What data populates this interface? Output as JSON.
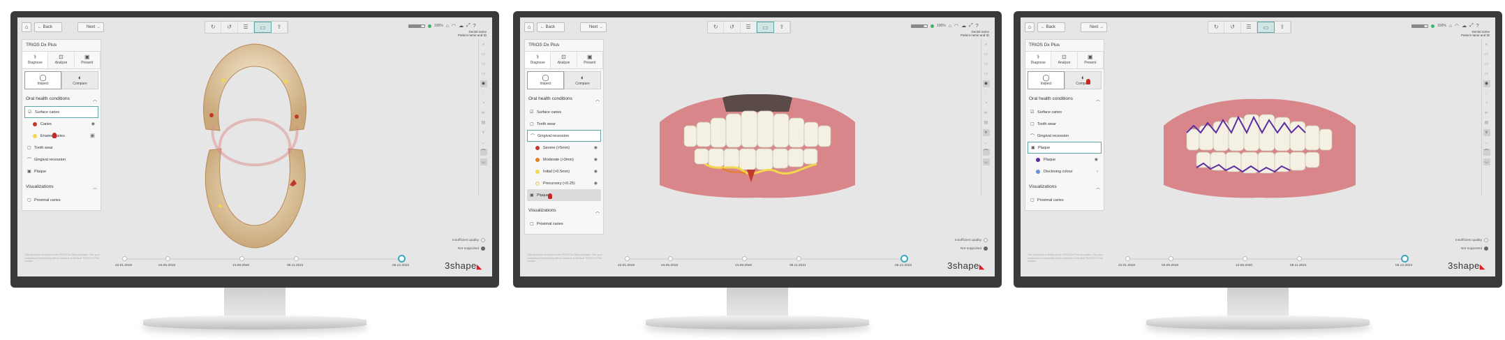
{
  "common": {
    "back_label": "Back",
    "next_label": "Next",
    "battery_percent": "100%",
    "patient_line1": "Dental name",
    "patient_line2": "Patient name and ID",
    "panel_title": "TRIOS Dx Plus",
    "modes": [
      "Diagnose",
      "Analyze",
      "Present"
    ],
    "inspect_label": "Inspect",
    "compare_label": "Compare",
    "oral_health_label": "Oral health conditions",
    "visualizations_label": "Visualizations",
    "proximal_caries_label": "Proximal caries",
    "insufficient_quality": "Insufficient quality",
    "not_supported": "Not supported",
    "disclaimer": "This simulation is limited to the TRIOS Dx Plus simulation. See your comparison functionality will be available in the final TRIOS Dx Plus release.",
    "timeline_dates": [
      "22.01.2018",
      "04.05.2018",
      "13.08.2020",
      "08.11.2021",
      "05.12.2023"
    ],
    "logo_text": "3shape",
    "icons": [
      "home-icon",
      "arrow-left-icon",
      "arrow-right-icon",
      "eye-icon",
      "chevron-up-icon",
      "wifi-icon",
      "gear-icon",
      "help-icon"
    ]
  },
  "screens": [
    {
      "items": {
        "surface_caries": "Surface caries",
        "caries": "Caries",
        "enamel_caries": "Enamel caries",
        "tooth_wear": "Tooth wear",
        "gingival_recession": "Gingival recession",
        "plaque": "Plaque"
      },
      "colors": {
        "caries": "#c0392b",
        "enamel_caries": "#f2d64b"
      }
    },
    {
      "items": {
        "surface_caries": "Surface caries",
        "tooth_wear": "Tooth wear",
        "gingival_recession": "Gingival recession",
        "severe": "Severe (>5mm)",
        "moderate": "Moderate (>3mm)",
        "initial": "Initial (>0.5mm)",
        "precursory": "Precursory (<0.25)",
        "plaque": "Plaque"
      },
      "colors": {
        "severe": "#c0392b",
        "moderate": "#e67e22",
        "initial": "#f2d64b",
        "precursory": "#f8f0c8"
      }
    },
    {
      "items": {
        "surface_caries": "Surface caries",
        "tooth_wear": "Tooth wear",
        "gingival_recession": "Gingival recession",
        "plaque": "Plaque",
        "plaque_sub": "Plaque",
        "disclosing_colour": "Disclosing colour"
      },
      "colors": {
        "plaque": "#5b2ca0",
        "disclosing_colour": "#6a8fd8"
      }
    }
  ]
}
